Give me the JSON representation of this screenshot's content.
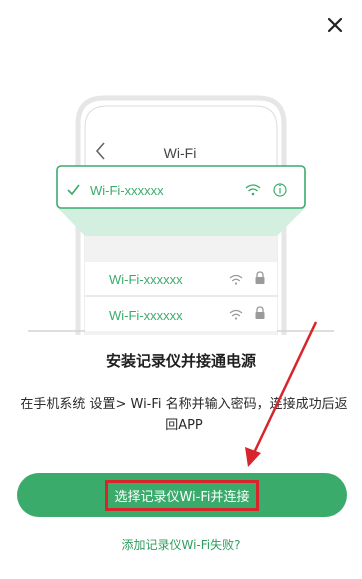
{
  "illustration": {
    "screen_title": "Wi-Fi",
    "selected_network": "Wi-Fi-xxxxxx",
    "networks": [
      "Wi-Fi-xxxxxx",
      "Wi-Fi-xxxxxx"
    ]
  },
  "heading": "安装记录仪并接通电源",
  "description": "在手机系统 设置> Wi-Fi 名称并输入密码，连接成功后返回APP",
  "primary_button": {
    "label": "选择记录仪Wi-Fi并连接"
  },
  "help_link": "添加记录仪Wi-Fi失败?",
  "colors": {
    "accent": "#3bab6c",
    "highlight": "#d7252b"
  },
  "icons": [
    "close-icon",
    "back-chevron-icon",
    "checkmark-icon",
    "wifi-icon",
    "info-icon",
    "lock-icon"
  ]
}
